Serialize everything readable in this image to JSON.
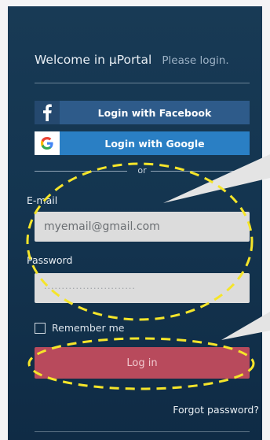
{
  "header": {
    "welcome": "Welcome in µPortal",
    "please": "Please login."
  },
  "social": {
    "facebook_label": "Login with Facebook",
    "google_label": "Login with Google"
  },
  "divider_text": "or",
  "form": {
    "email_label": "E-mail",
    "email_placeholder": "myemail@gmail.com",
    "password_label": "Password",
    "password_value": "··························",
    "remember_label": "Remember me",
    "remember_checked": false,
    "login_label": "Log in",
    "forgot_label": "Forgot password?"
  },
  "icons": {
    "facebook": "facebook-icon",
    "google": "google-icon"
  },
  "colors": {
    "panel": "#143550",
    "facebook": "#2e5b8a",
    "google": "#2a7fc4",
    "login": "#b84a5c",
    "annotation": "#f5e52a"
  }
}
